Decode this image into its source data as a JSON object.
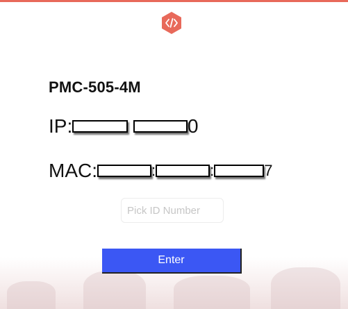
{
  "device": {
    "model": "PMC-505-4M",
    "ip_label": "IP:",
    "ip_tail": "0",
    "mac_label": "MAC: ",
    "mac_separator": ":",
    "mac_tail": "7"
  },
  "form": {
    "id_placeholder": "Pick ID Number",
    "enter_label": "Enter"
  },
  "colors": {
    "accent": "#e8695a",
    "button": "#3b57f4"
  },
  "icons": {
    "logo": "code-hexagon-icon"
  }
}
